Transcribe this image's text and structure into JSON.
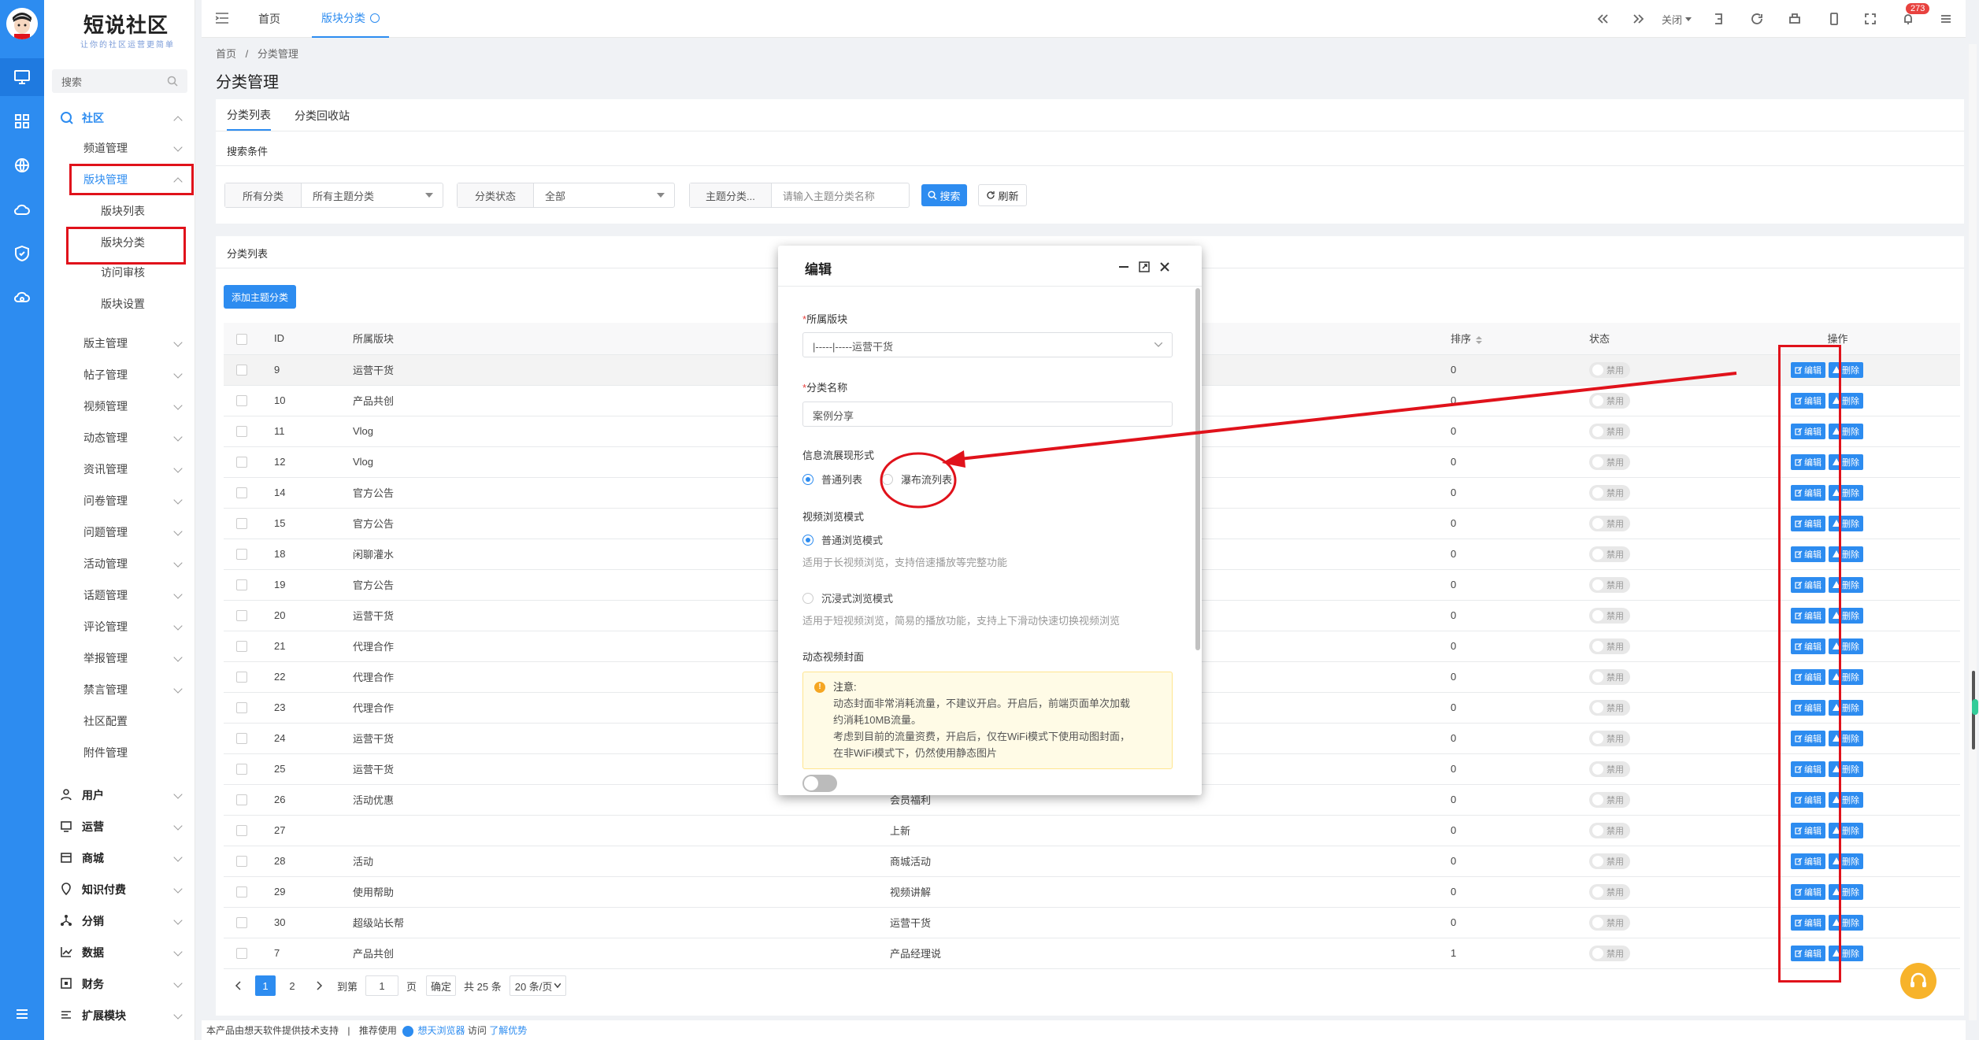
{
  "brand": {
    "logo": "短说社区",
    "slogan": "让你的社区运营更简单"
  },
  "sidebar": {
    "search_placeholder": "搜索",
    "sections": [
      {
        "label": "社区",
        "icon": "community-icon"
      },
      {
        "label": "用户",
        "icon": "user-icon"
      },
      {
        "label": "运营",
        "icon": "operation-icon"
      },
      {
        "label": "商城",
        "icon": "shop-icon"
      },
      {
        "label": "知识付费",
        "icon": "location-icon"
      },
      {
        "label": "分销",
        "icon": "distribution-icon"
      },
      {
        "label": "数据",
        "icon": "chart-icon"
      },
      {
        "label": "财务",
        "icon": "finance-icon"
      },
      {
        "label": "扩展模块",
        "icon": "extend-icon"
      }
    ],
    "community_items": [
      "频道管理",
      "版块管理",
      "版块列表",
      "版块分类",
      "访问审核",
      "版块设置",
      "版主管理",
      "帖子管理",
      "视频管理",
      "动态管理",
      "资讯管理",
      "问卷管理",
      "问题管理",
      "活动管理",
      "话题管理",
      "评论管理",
      "举报管理",
      "禁言管理",
      "社区配置",
      "附件管理"
    ]
  },
  "topbar": {
    "tabs": [
      {
        "label": "首页"
      },
      {
        "label": "版块分类"
      }
    ],
    "close_label": "关闭",
    "badge": "273"
  },
  "breadcrumb": {
    "home": "首页",
    "sep": "/",
    "current": "分类管理"
  },
  "page_title": "分类管理",
  "subtabs": [
    "分类列表",
    "分类回收站"
  ],
  "filters": {
    "section_title": "搜索条件",
    "f1_label": "所有分类",
    "f1_value": "所有主题分类",
    "f2_label": "分类状态",
    "f2_value": "全部",
    "f3_label": "主题分类...",
    "f3_placeholder": "请输入主题分类名称",
    "search_btn": "搜索",
    "refresh_btn": "刷新"
  },
  "list": {
    "section_title": "分类列表",
    "add_btn": "添加主题分类",
    "headers": {
      "id": "ID",
      "section": "所属版块",
      "sort": "排序",
      "status": "状态",
      "ops": "操作"
    },
    "edit_label": "编辑",
    "delete_label": "删除",
    "status_label": "禁用"
  },
  "rows": [
    {
      "id": "9",
      "section": "运营干货",
      "name": "",
      "sort": "0"
    },
    {
      "id": "10",
      "section": "产品共创",
      "name": "",
      "sort": "0"
    },
    {
      "id": "11",
      "section": "Vlog",
      "name": "",
      "sort": "0"
    },
    {
      "id": "12",
      "section": "Vlog",
      "name": "",
      "sort": "0"
    },
    {
      "id": "14",
      "section": "官方公告",
      "name": "",
      "sort": "0"
    },
    {
      "id": "15",
      "section": "官方公告",
      "name": "",
      "sort": "0"
    },
    {
      "id": "18",
      "section": "闲聊灌水",
      "name": "",
      "sort": "0"
    },
    {
      "id": "19",
      "section": "官方公告",
      "name": "",
      "sort": "0"
    },
    {
      "id": "20",
      "section": "运营干货",
      "name": "",
      "sort": "0"
    },
    {
      "id": "21",
      "section": "代理合作",
      "name": "",
      "sort": "0"
    },
    {
      "id": "22",
      "section": "代理合作",
      "name": "",
      "sort": "0"
    },
    {
      "id": "23",
      "section": "代理合作",
      "name": "",
      "sort": "0"
    },
    {
      "id": "24",
      "section": "运营干货",
      "name": "",
      "sort": "0"
    },
    {
      "id": "25",
      "section": "运营干货",
      "name": "",
      "sort": "0"
    },
    {
      "id": "26",
      "section": "活动优惠",
      "name": "会员福利",
      "sort": "0"
    },
    {
      "id": "27",
      "section": "",
      "name": "上新",
      "sort": "0"
    },
    {
      "id": "28",
      "section": "活动",
      "name": "商城活动",
      "sort": "0"
    },
    {
      "id": "29",
      "section": "使用帮助",
      "name": "视频讲解",
      "sort": "0"
    },
    {
      "id": "30",
      "section": "超级站长帮",
      "name": "运营干货",
      "sort": "0"
    },
    {
      "id": "7",
      "section": "产品共创",
      "name": "产品经理说",
      "sort": "1"
    }
  ],
  "pagination": {
    "page": "1",
    "page2": "2",
    "goto": "到第",
    "page_input": "1",
    "page_unit": "页",
    "confirm": "确定",
    "total": "共 25 条",
    "per_page": "20 条/页"
  },
  "footer": {
    "text1": "本产品由想天软件提供技术支持",
    "sep": "|",
    "text2": "推荐使用",
    "browser": "想天浏览器",
    "text3": "访问",
    "link": "了解优势"
  },
  "modal": {
    "title": "编辑",
    "field1_label": "所属版块",
    "field1_value": "|-----|-----运营干货",
    "field2_label": "分类名称",
    "field2_value": "案例分享",
    "field3_label": "信息流展现形式",
    "radio_normal": "普通列表",
    "radio_waterfall": "瀑布流列表",
    "field4_label": "视频浏览模式",
    "video_normal": "普通浏览模式",
    "video_normal_hint": "适用于长视频浏览，支持倍速播放等完整功能",
    "video_immersive": "沉浸式浏览模式",
    "video_immersive_hint": "适用于短视频浏览，简易的播放功能，支持上下滑动快速切换视频浏览",
    "field5_label": "动态视频封面",
    "warn_title": "注意:",
    "warn_l1": "动态封面非常消耗流量，不建议开启。开启后，前端页面单次加载",
    "warn_l2": "约消耗10MB流量。",
    "warn_l3": "考虑到目前的流量资费，开启后，仅在WiFi模式下使用动图封面，",
    "warn_l4": "在非WiFi模式下，仍然使用静态图片"
  },
  "colors": {
    "primary": "#2d8cf0",
    "annotation": "#e0121b"
  }
}
